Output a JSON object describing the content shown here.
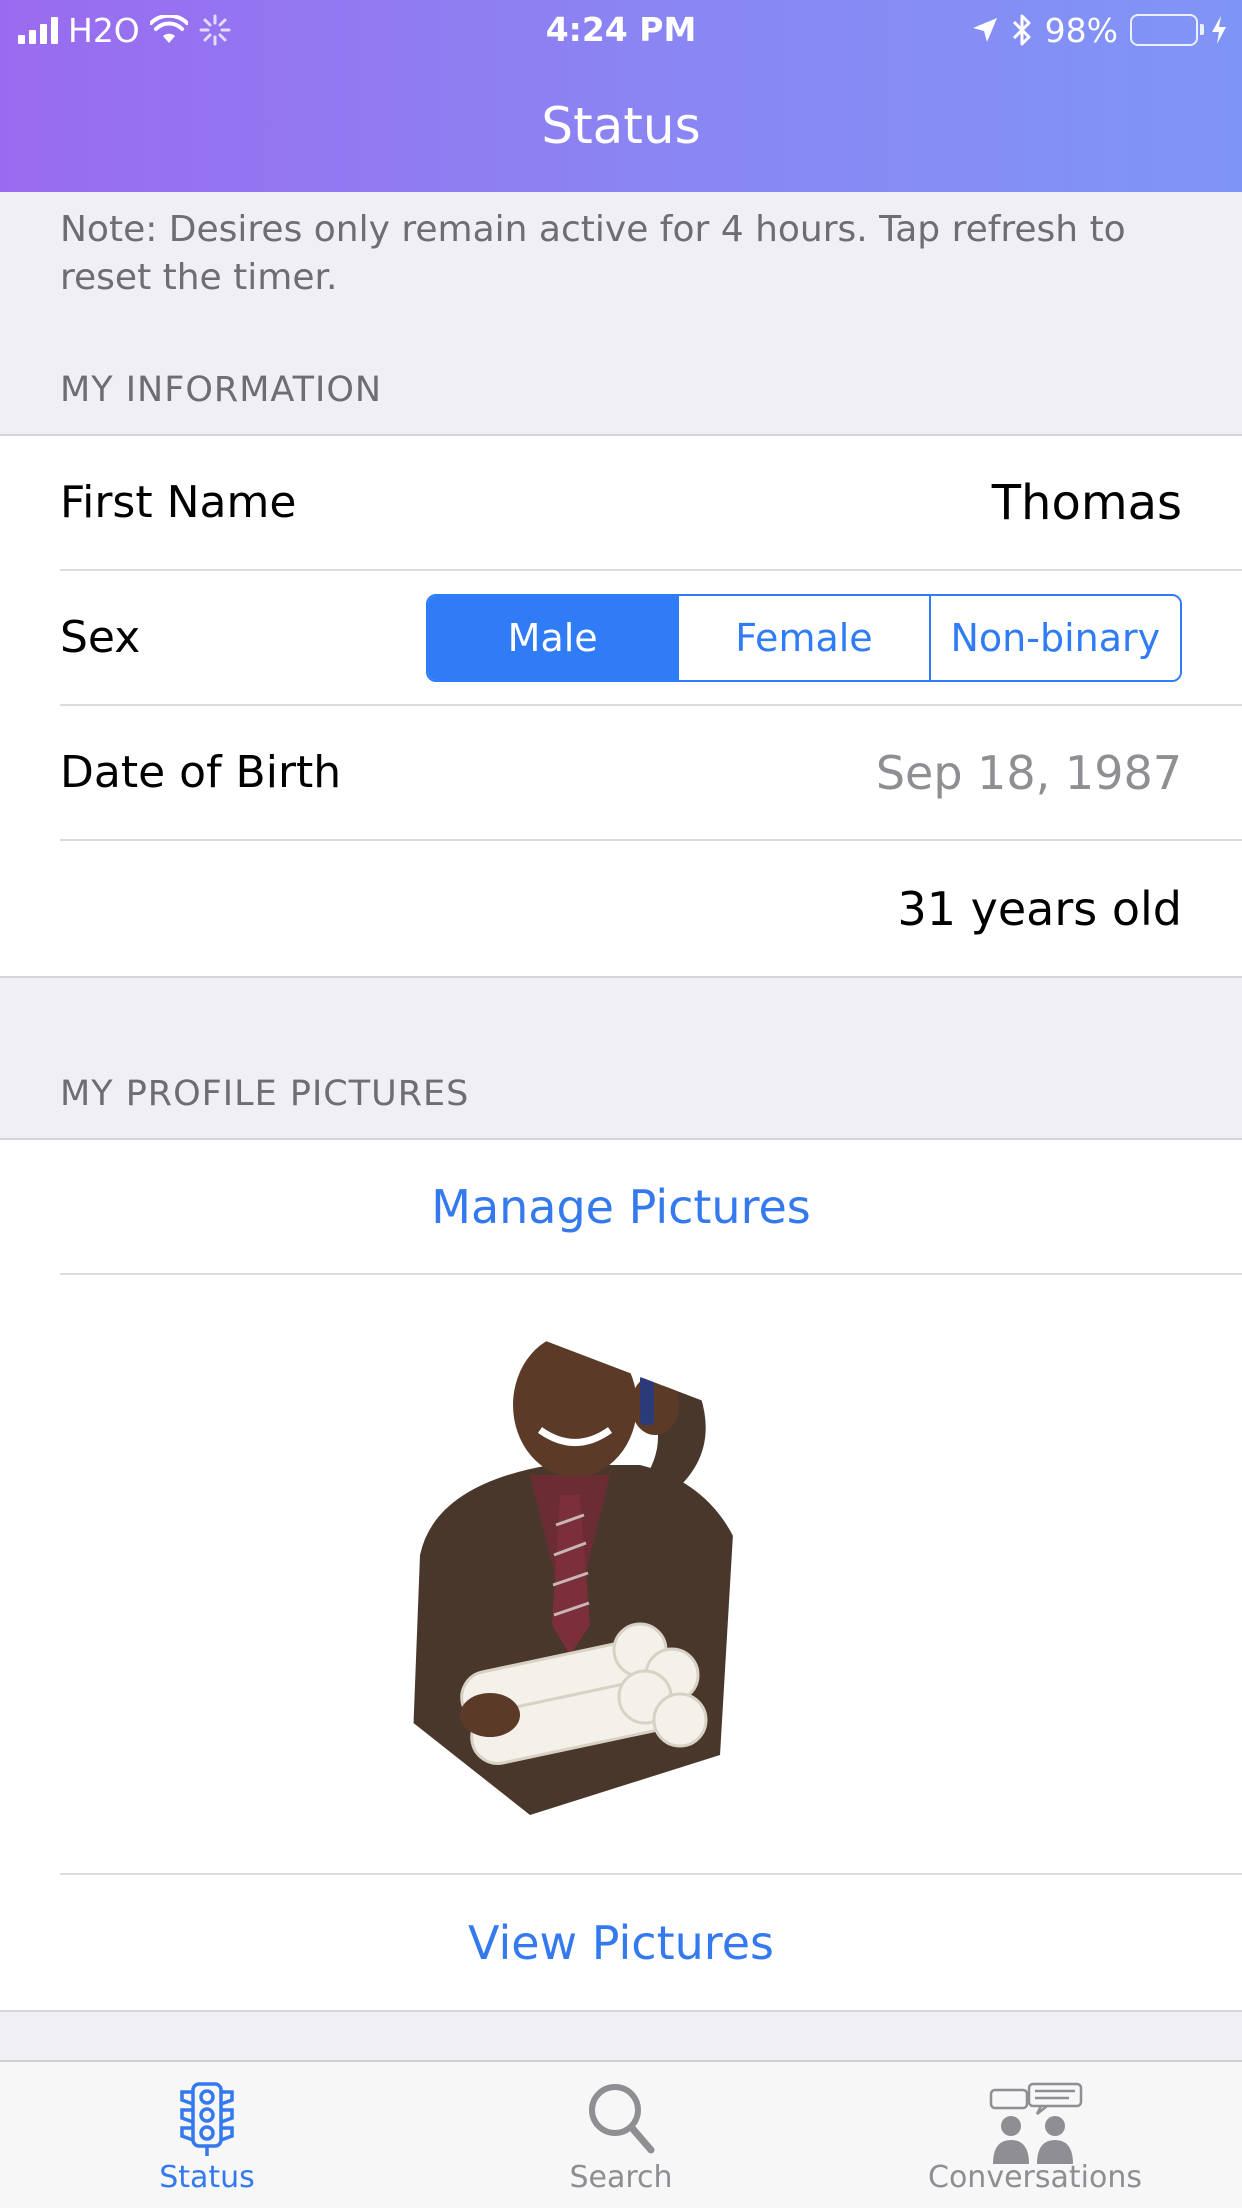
{
  "status_bar": {
    "carrier": "H2O",
    "time": "4:24 PM",
    "battery_percent": "98%",
    "battery_level": 0.98
  },
  "nav": {
    "title": "Status"
  },
  "note": "Note: Desires only remain active for 4 hours. Tap refresh to reset the timer.",
  "my_information": {
    "header": "MY INFORMATION",
    "first_name_label": "First Name",
    "first_name_value": "Thomas",
    "sex_label": "Sex",
    "sex_options": [
      "Male",
      "Female",
      "Non-binary"
    ],
    "sex_selected": "Male",
    "dob_label": "Date of Birth",
    "dob_value": "Sep 18, 1987",
    "age_value": "31 years old"
  },
  "profile_pictures": {
    "header": "MY PROFILE PICTURES",
    "manage_label": "Manage Pictures",
    "view_label": "View Pictures"
  },
  "tabbar": {
    "items": [
      {
        "label": "Status",
        "icon": "traffic-light-icon",
        "active": true
      },
      {
        "label": "Search",
        "icon": "search-icon",
        "active": false
      },
      {
        "label": "Conversations",
        "icon": "conversations-icon",
        "active": false
      }
    ]
  },
  "colors": {
    "accent": "#3479ee",
    "header_gradient_start": "#9a6bf0",
    "header_gradient_end": "#7f95f6",
    "battery": "#4cd964"
  }
}
